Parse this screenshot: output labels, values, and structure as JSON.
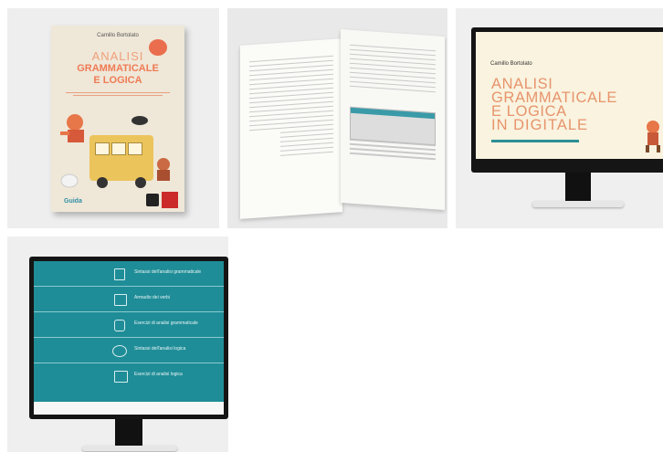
{
  "cover": {
    "author": "Camillo Bortolato",
    "title_line1": "ANALISI",
    "title_line2": "GRAMMATICALE",
    "title_line3": "E LOGICA",
    "guide_label": "Guida",
    "colors": {
      "accent": "#ef7b55",
      "teal": "#2f8fa5",
      "publisher_red": "#cc2a2a"
    }
  },
  "title_screen": {
    "author": "Camillo Bortolato",
    "line1": "ANALISI",
    "line2": "GRAMMATICALE",
    "line3": "E LOGICA",
    "line4": "IN DIGITALE",
    "colors": {
      "background": "#f9f3df",
      "text": "#e7946c",
      "bar": "#2c8f96"
    }
  },
  "menu": {
    "items": [
      {
        "label": "Sintassi dell'analisi grammaticale",
        "icon": "book-icon"
      },
      {
        "label": "Armadio dei verbi",
        "icon": "wardrobe-icon"
      },
      {
        "label": "Esercizi di analisi grammaticale",
        "icon": "jar-icon"
      },
      {
        "label": "Sintassi dell'analisi logica",
        "icon": "bicycle-icon"
      },
      {
        "label": "Esercizi di analisi logica",
        "icon": "box-icon"
      }
    ],
    "colors": {
      "background": "#1f8d97"
    }
  }
}
